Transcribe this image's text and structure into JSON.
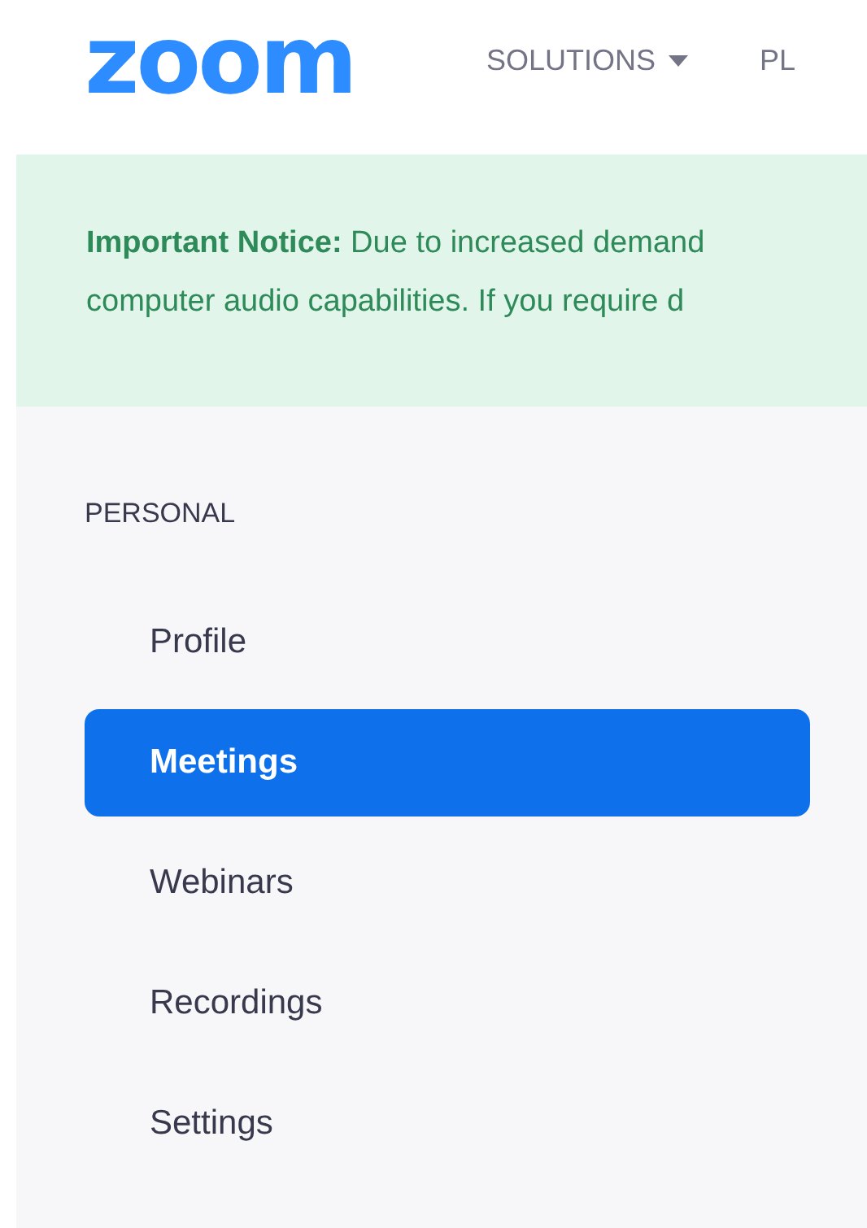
{
  "header": {
    "logo": "zoom",
    "nav": [
      {
        "label": "SOLUTIONS",
        "dropdown": true
      },
      {
        "label": "PL",
        "dropdown": false
      }
    ]
  },
  "notice": {
    "lines": [
      "**Important Notice:** Due to increased demand",
      "computer audio capabilities. If you require d"
    ]
  },
  "sidebar": {
    "section": "PERSONAL",
    "items": [
      {
        "label": "Profile",
        "selected": false
      },
      {
        "label": "Meetings",
        "selected": true
      },
      {
        "label": "Webinars",
        "selected": false
      },
      {
        "label": "Recordings",
        "selected": false
      },
      {
        "label": "Settings",
        "selected": false
      }
    ]
  }
}
